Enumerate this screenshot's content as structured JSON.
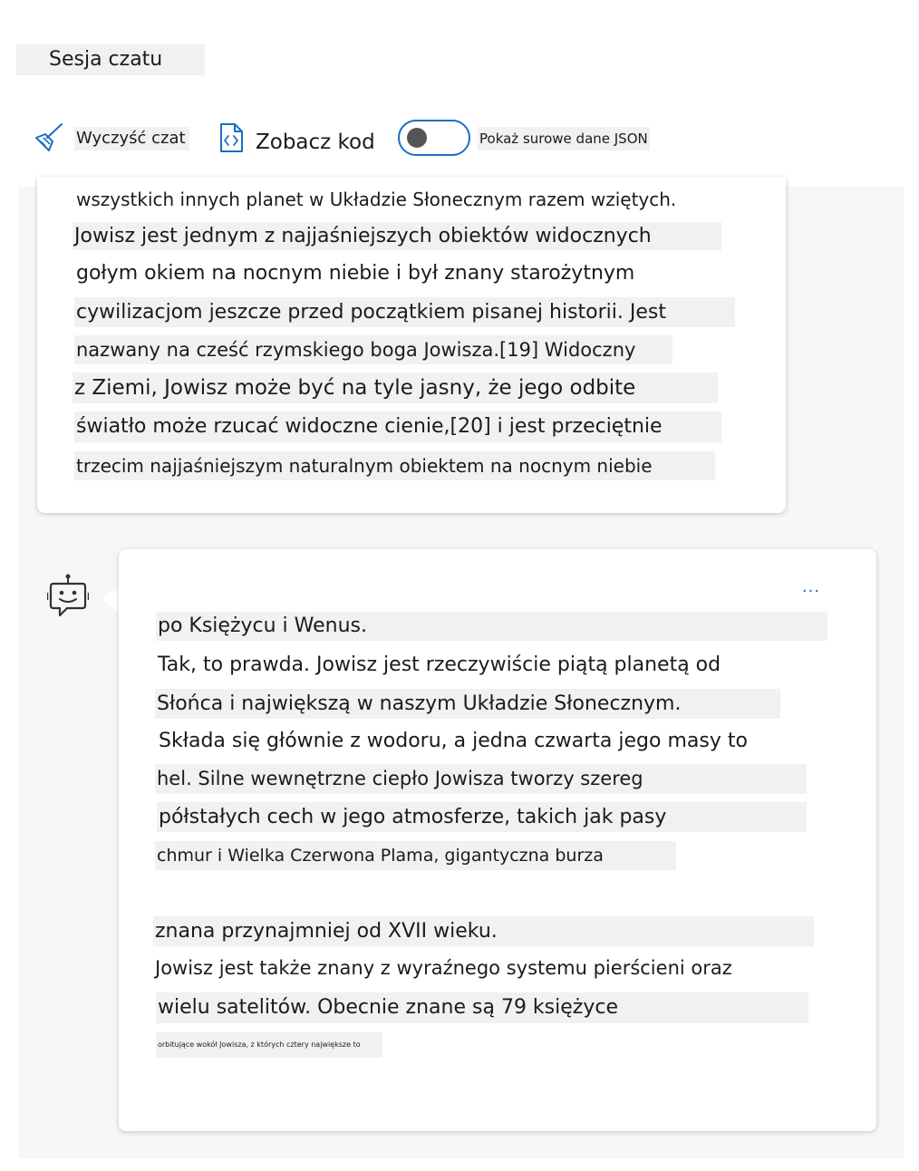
{
  "session": {
    "title": "Sesja czatu"
  },
  "toolbar": {
    "clear_label": "Wyczyść czat",
    "clear_icon": "broom-icon",
    "code_label": "Zobacz kod",
    "code_icon": "code-file-icon",
    "json_toggle_label": "Pokaż surowe dane JSON",
    "json_toggle_on": false
  },
  "messages": {
    "previous": {
      "lines": [
        "wszystkich innych planet w Układzie Słonecznym razem wziętych.",
        "Jowisz jest jednym z najjaśniejszych obiektów widocznych",
        "gołym okiem na nocnym niebie i był znany starożytnym",
        "cywilizacjom jeszcze przed początkiem pisanej historii. Jest",
        "nazwany na cześć rzymskiego boga Jowisza.[19] Widoczny",
        "z Ziemi, Jowisz może być na tyle jasny, że jego odbite",
        "światło może rzucać widoczne cienie,[20] i jest przeciętnie",
        "trzecim najjaśniejszym naturalnym obiektem na nocnym niebie"
      ]
    },
    "bot": {
      "avatar_icon": "bot-icon",
      "more_label": "...",
      "lines": [
        "po Księżycu i Wenus.",
        "Tak, to prawda. Jowisz jest rzeczywiście piątą planetą od",
        "Słońca i największą w naszym Układzie Słonecznym.",
        "Składa się głównie z wodoru, a jedna czwarta jego masy to",
        "hel. Silne wewnętrzne ciepło Jowisza tworzy szereg",
        "półstałych cech w jego atmosferze, takich jak pasy",
        "chmur i Wielka Czerwona Plama, gigantyczna burza",
        "znana przynajmniej od XVII wieku.",
        "Jowisz jest także znany z wyraźnego systemu pierścieni oraz",
        "wielu satelitów. Obecnie znane są 79 księżyce",
        "orbitujące wokół Jowisza, z których cztery największe to"
      ]
    }
  },
  "colors": {
    "accent": "#1b6ec2",
    "text": "#1b1b1b",
    "highlight": "#f1f1f1",
    "chat_background": "#f7f7f7"
  }
}
